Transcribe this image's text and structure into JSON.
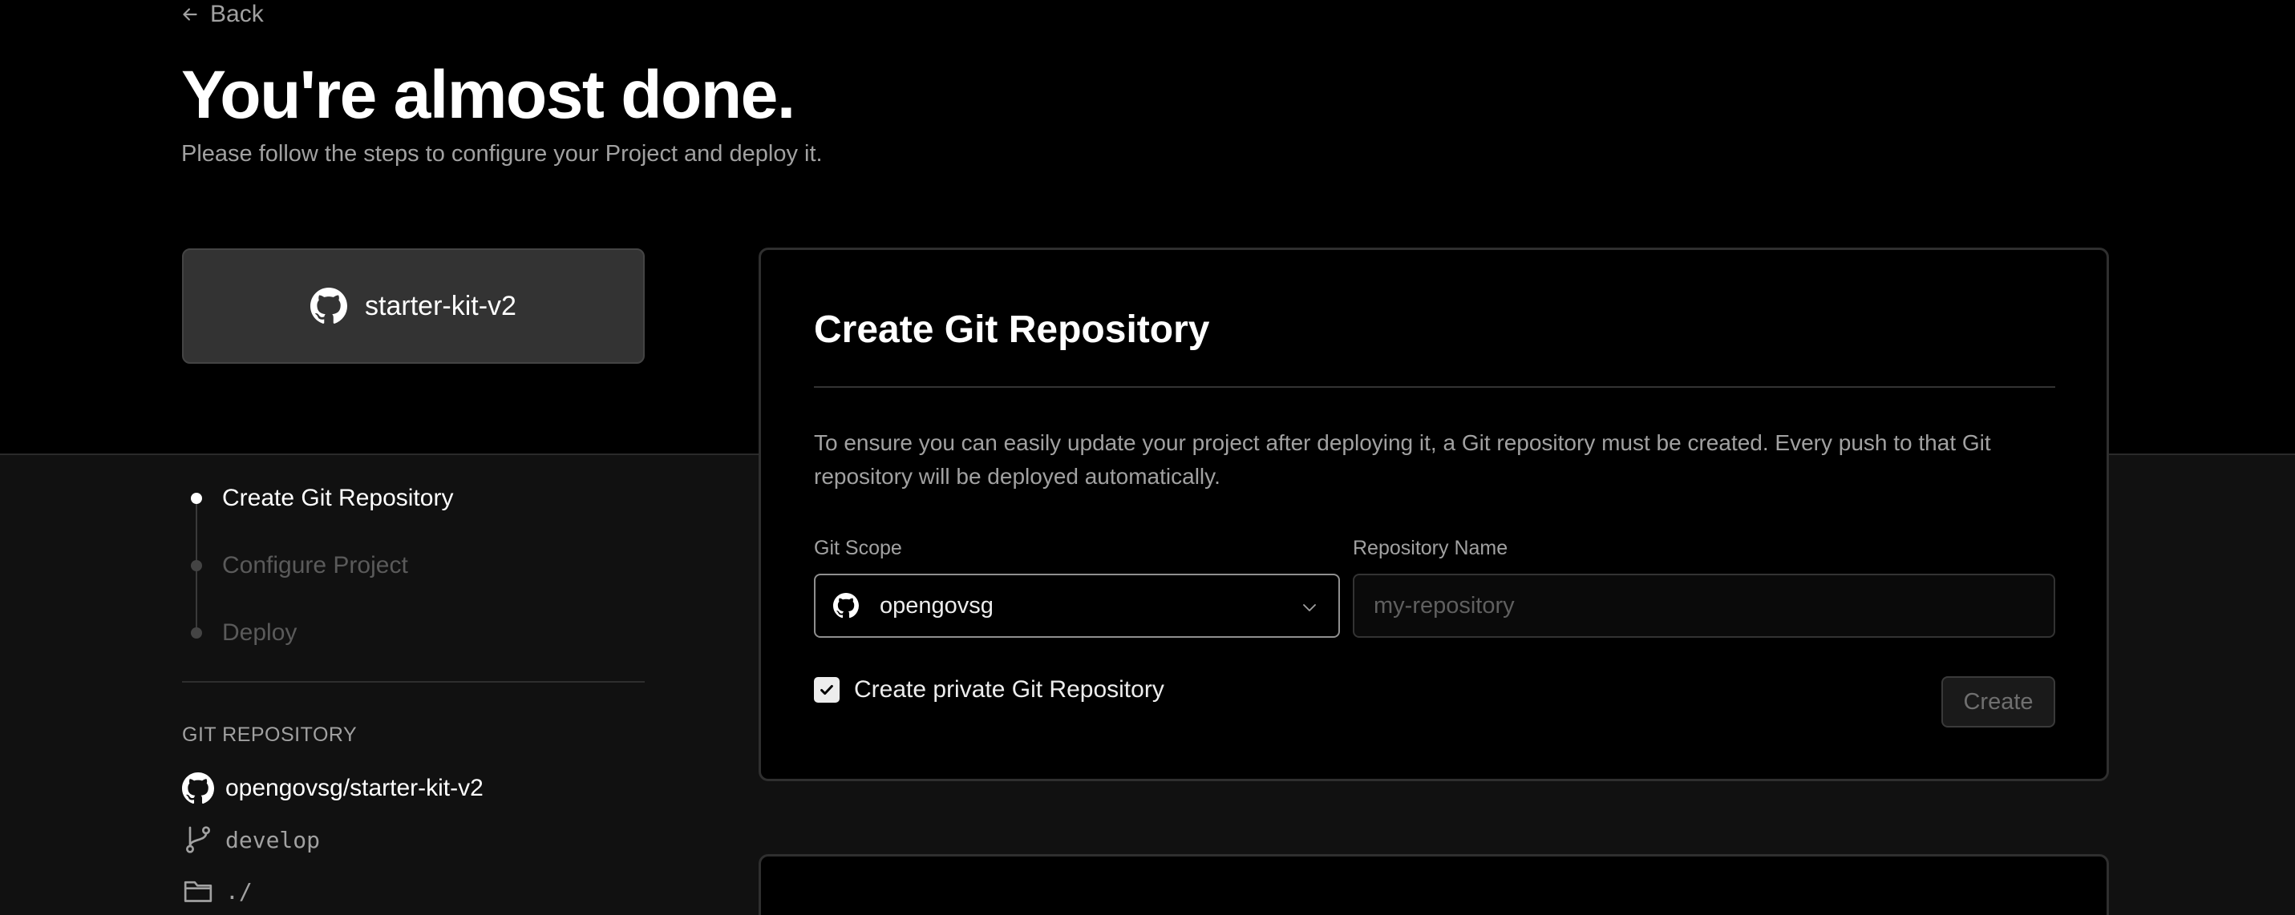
{
  "header": {
    "back_label": "Back",
    "title": "You're almost done.",
    "subtitle": "Please follow the steps to configure your Project and deploy it."
  },
  "repo_card": {
    "name": "starter-kit-v2",
    "icon": "github-icon"
  },
  "steps": [
    {
      "label": "Create Git Repository",
      "state": "active"
    },
    {
      "label": "Configure Project",
      "state": "inactive"
    },
    {
      "label": "Deploy",
      "state": "inactive"
    }
  ],
  "git_repository": {
    "heading": "GIT REPOSITORY",
    "repo": "opengovsg/starter-kit-v2",
    "branch": "develop",
    "directory": "./"
  },
  "create_panel": {
    "title": "Create Git Repository",
    "description": "To ensure you can easily update your project after deploying it, a Git repository must be created. Every push to that Git repository will be deployed automatically.",
    "scope_label": "Git Scope",
    "scope_value": "opengovsg",
    "repo_name_label": "Repository Name",
    "repo_name_value": "",
    "repo_name_placeholder": "my-repository",
    "private_label": "Create private Git Repository",
    "private_checked": true,
    "create_button": "Create"
  },
  "colors": {
    "background": "#111111",
    "hero": "#000000",
    "text": "#ededed",
    "muted": "#a1a1a1"
  }
}
